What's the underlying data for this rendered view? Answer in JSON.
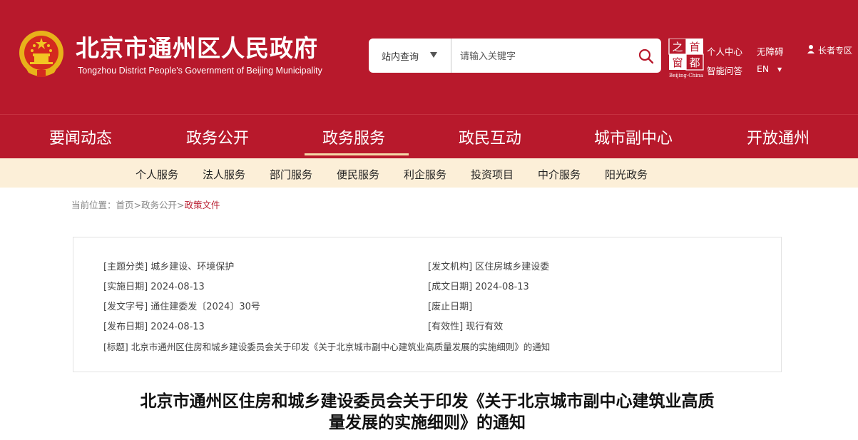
{
  "site": {
    "title_cn": "北京市通州区人民政府",
    "title_en": "Tongzhou District People's Government of Beijing Municipality",
    "logo_caption": "Beijing-China",
    "logo_chars": [
      "首",
      "都",
      "之",
      "窗"
    ]
  },
  "search": {
    "scope_label": "站内查询",
    "placeholder": "请输入关键字"
  },
  "top_links": {
    "personal_center": "个人中心",
    "accessibility": "无障碍",
    "smart_qa": "智能问答",
    "language": "EN",
    "elder_zone": "长者专区"
  },
  "nav": {
    "items": [
      "要闻动态",
      "政务公开",
      "政务服务",
      "政民互动",
      "城市副中心",
      "开放通州"
    ],
    "active_index": 2
  },
  "subnav": {
    "items": [
      "个人服务",
      "法人服务",
      "部门服务",
      "便民服务",
      "利企服务",
      "投资项目",
      "中介服务",
      "阳光政务"
    ]
  },
  "breadcrumb": {
    "prefix": "当前位置：",
    "home": "首页",
    "sep": ">",
    "level1": "政务公开",
    "current": "政策文件"
  },
  "doc_info": {
    "topic": "[主题分类] 城乡建设、环境保护",
    "issuer": "[发文机构] 区住房城乡建设委",
    "effective_date": "[实施日期] 2024-08-13",
    "written_date": "[成文日期] 2024-08-13",
    "doc_number": "[发文字号] 通住建委发〔2024〕30号",
    "abolish_date": "[废止日期]",
    "publish_date": "[发布日期] 2024-08-13",
    "validity": "[有效性] 现行有效",
    "title": "[标题] 北京市通州区住房和城乡建设委员会关于印发《关于北京城市副中心建筑业高质量发展的实施细则》的通知"
  },
  "document": {
    "title_line1": "北京市通州区住房和城乡建设委员会关于印发《关于北京城市副中心建筑业高质",
    "title_line2": "量发展的实施细则》的通知"
  },
  "colors": {
    "header_red": "#b8192c",
    "subnav_bg": "#fcefd8",
    "active_underline": "#f4d9a8"
  }
}
